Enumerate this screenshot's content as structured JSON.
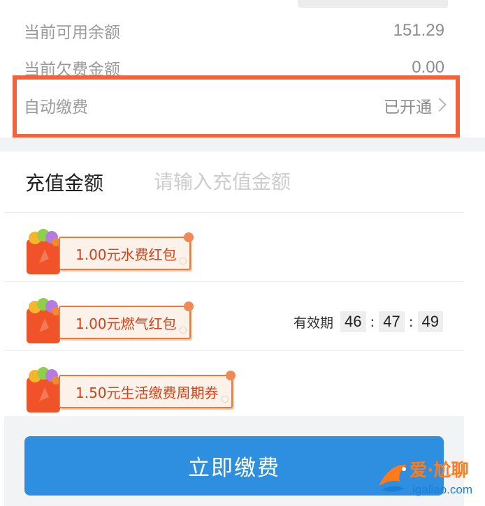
{
  "account": {
    "rows": [
      {
        "label": "当前可用余额",
        "value": "151.29"
      },
      {
        "label": "当前欠费金额",
        "value": "0.00"
      },
      {
        "label": "自动缴费",
        "value": "已开通"
      }
    ]
  },
  "recharge": {
    "label": "充值金额",
    "placeholder": "请输入充值金额"
  },
  "coupons": [
    {
      "text": "1.00元水费红包"
    },
    {
      "text": "1.00元燃气红包",
      "validity_label": "有效期",
      "countdown": {
        "h": "46",
        "m": "47",
        "s": "49"
      }
    },
    {
      "text": "1.50元生活缴费周期券"
    }
  ],
  "pay_button": {
    "label": "立即缴费"
  },
  "watermark": {
    "brand": "爱·尬聊",
    "domain": "igaliao.com"
  },
  "colors": {
    "highlight": "#f2623b",
    "primary": "#2e8fe0",
    "coupon_text": "#d5421a"
  }
}
